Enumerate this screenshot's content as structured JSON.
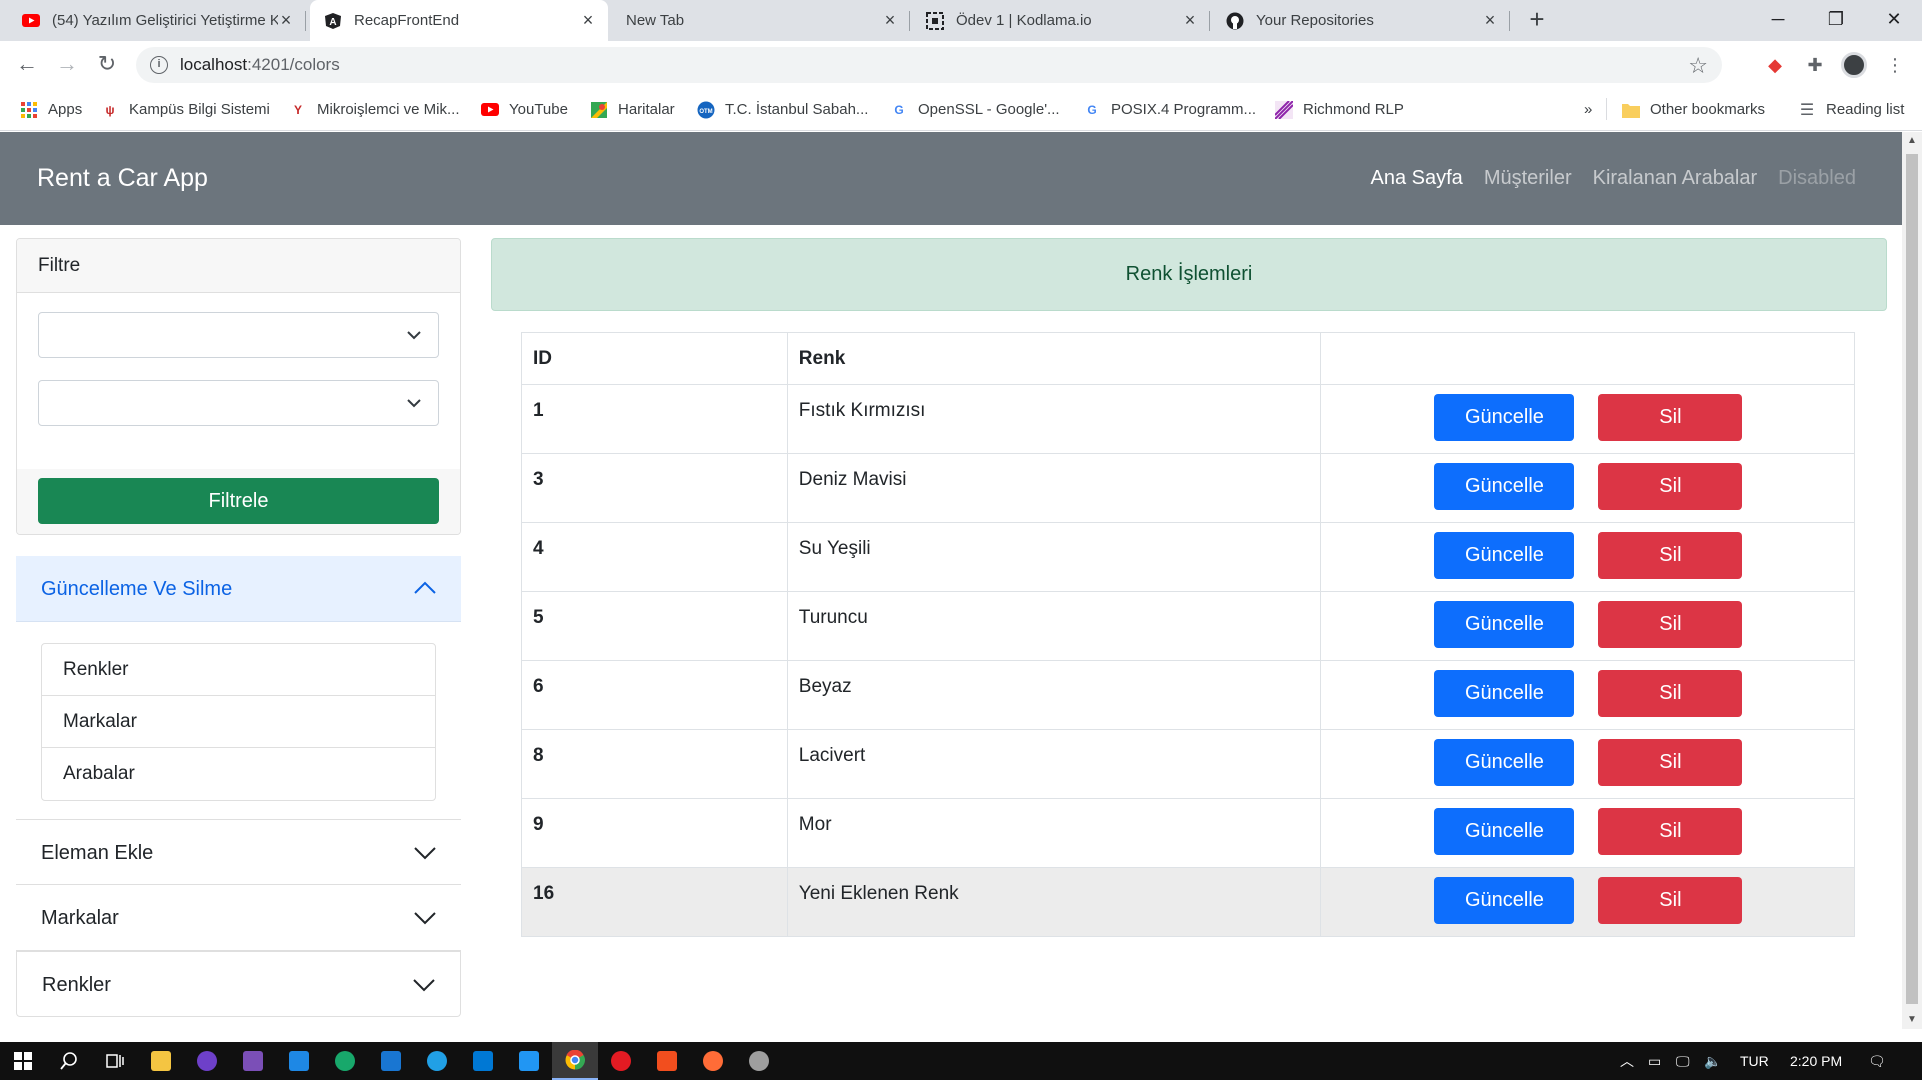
{
  "browser": {
    "tabs": [
      {
        "title": "(54) Yazılım Geliştirici Yetiştirme K",
        "icon": "youtube-icon",
        "color": "#ff0000",
        "active": false
      },
      {
        "title": "RecapFrontEnd",
        "icon": "angular-icon",
        "color": "#202124",
        "active": true
      },
      {
        "title": "New Tab",
        "icon": "",
        "color": "",
        "active": false
      },
      {
        "title": "Ödev 1 | Kodlama.io",
        "icon": "kodlama-icon",
        "color": "#202124",
        "active": false
      },
      {
        "title": "Your Repositories",
        "icon": "github-icon",
        "color": "#202124",
        "active": false
      }
    ],
    "url_host": "localhost",
    "url_path": ":4201/colors",
    "bookmarks": [
      {
        "label": "Apps",
        "icon": "apps-grid-icon",
        "color": "#ea4335"
      },
      {
        "label": "Kampüs Bilgi Sistemi",
        "icon": "kampus-icon",
        "color": "#c62828"
      },
      {
        "label": "Mikroişlemci ve Mik...",
        "icon": "ytu-icon",
        "color": "#c62828"
      },
      {
        "label": "YouTube",
        "icon": "youtube-icon",
        "color": "#ff0000"
      },
      {
        "label": "Haritalar",
        "icon": "maps-icon",
        "color": "#34a853"
      },
      {
        "label": "T.C. İstanbul Sabah...",
        "icon": "otm-icon",
        "color": "#1565c0"
      },
      {
        "label": "OpenSSL - Google'...",
        "icon": "google-icon",
        "color": "#4285f4"
      },
      {
        "label": "POSIX.4 Programm...",
        "icon": "google-icon",
        "color": "#4285f4"
      },
      {
        "label": "Richmond RLP",
        "icon": "richmond-icon",
        "color": "#8e24aa"
      }
    ],
    "bookmarks_overflow": "»",
    "other_bookmarks": "Other bookmarks",
    "reading_list": "Reading list"
  },
  "app": {
    "brand": "Rent a Car App",
    "nav": [
      {
        "label": "Ana Sayfa",
        "state": "active"
      },
      {
        "label": "Müşteriler",
        "state": "normal"
      },
      {
        "label": "Kiralanan Arabalar",
        "state": "normal"
      },
      {
        "label": "Disabled",
        "state": "disabled"
      }
    ],
    "filter": {
      "title": "Filtre",
      "select1_value": "",
      "select2_value": "",
      "button": "Filtrele"
    },
    "accordion": {
      "open_title": "Güncelleme Ve Silme",
      "items": [
        "Renkler",
        "Markalar",
        "Arabalar"
      ],
      "collapsed": [
        "Eleman Ekle",
        "Markalar",
        "Renkler"
      ]
    },
    "alert": "Renk İşlemleri",
    "table": {
      "headers": [
        "ID",
        "Renk",
        ""
      ],
      "update_label": "Güncelle",
      "delete_label": "Sil",
      "rows": [
        {
          "id": "1",
          "name": "Fıstık Kırmızısı"
        },
        {
          "id": "3",
          "name": "Deniz Mavisi"
        },
        {
          "id": "4",
          "name": "Su Yeşili"
        },
        {
          "id": "5",
          "name": "Turuncu"
        },
        {
          "id": "6",
          "name": "Beyaz"
        },
        {
          "id": "8",
          "name": "Lacivert"
        },
        {
          "id": "9",
          "name": "Mor"
        },
        {
          "id": "16",
          "name": "Yeni Eklenen Renk"
        }
      ]
    }
  },
  "colors": {
    "navbar": "#6c757d",
    "primary": "#0d6efd",
    "danger": "#dc3545",
    "success": "#198754",
    "alert_bg": "#d1e7dd"
  },
  "taskbar": {
    "apps": [
      {
        "icon": "file-explorer-icon",
        "color": "#f4c542"
      },
      {
        "icon": "github-desktop-icon",
        "color": "#6e40c9"
      },
      {
        "icon": "visual-studio-icon",
        "color": "#7b4fb7"
      },
      {
        "icon": "vscode-icon",
        "color": "#1e88e5"
      },
      {
        "icon": "gitkraken-icon",
        "color": "#18a86b"
      },
      {
        "icon": "app-icon",
        "color": "#1976d2"
      },
      {
        "icon": "edge-icon",
        "color": "#21a0e6"
      },
      {
        "icon": "store-icon",
        "color": "#0078d4"
      },
      {
        "icon": "mail-icon",
        "color": "#2196f3"
      },
      {
        "icon": "chrome-icon",
        "color": "#fbbc05"
      },
      {
        "icon": "opera-icon",
        "color": "#e31b23"
      },
      {
        "icon": "figma-icon",
        "color": "#f24e1e"
      },
      {
        "icon": "postman-icon",
        "color": "#ff6c37"
      },
      {
        "icon": "app2-icon",
        "color": "#9e9e9e"
      }
    ],
    "language": "TUR",
    "time": "2:20 PM"
  }
}
